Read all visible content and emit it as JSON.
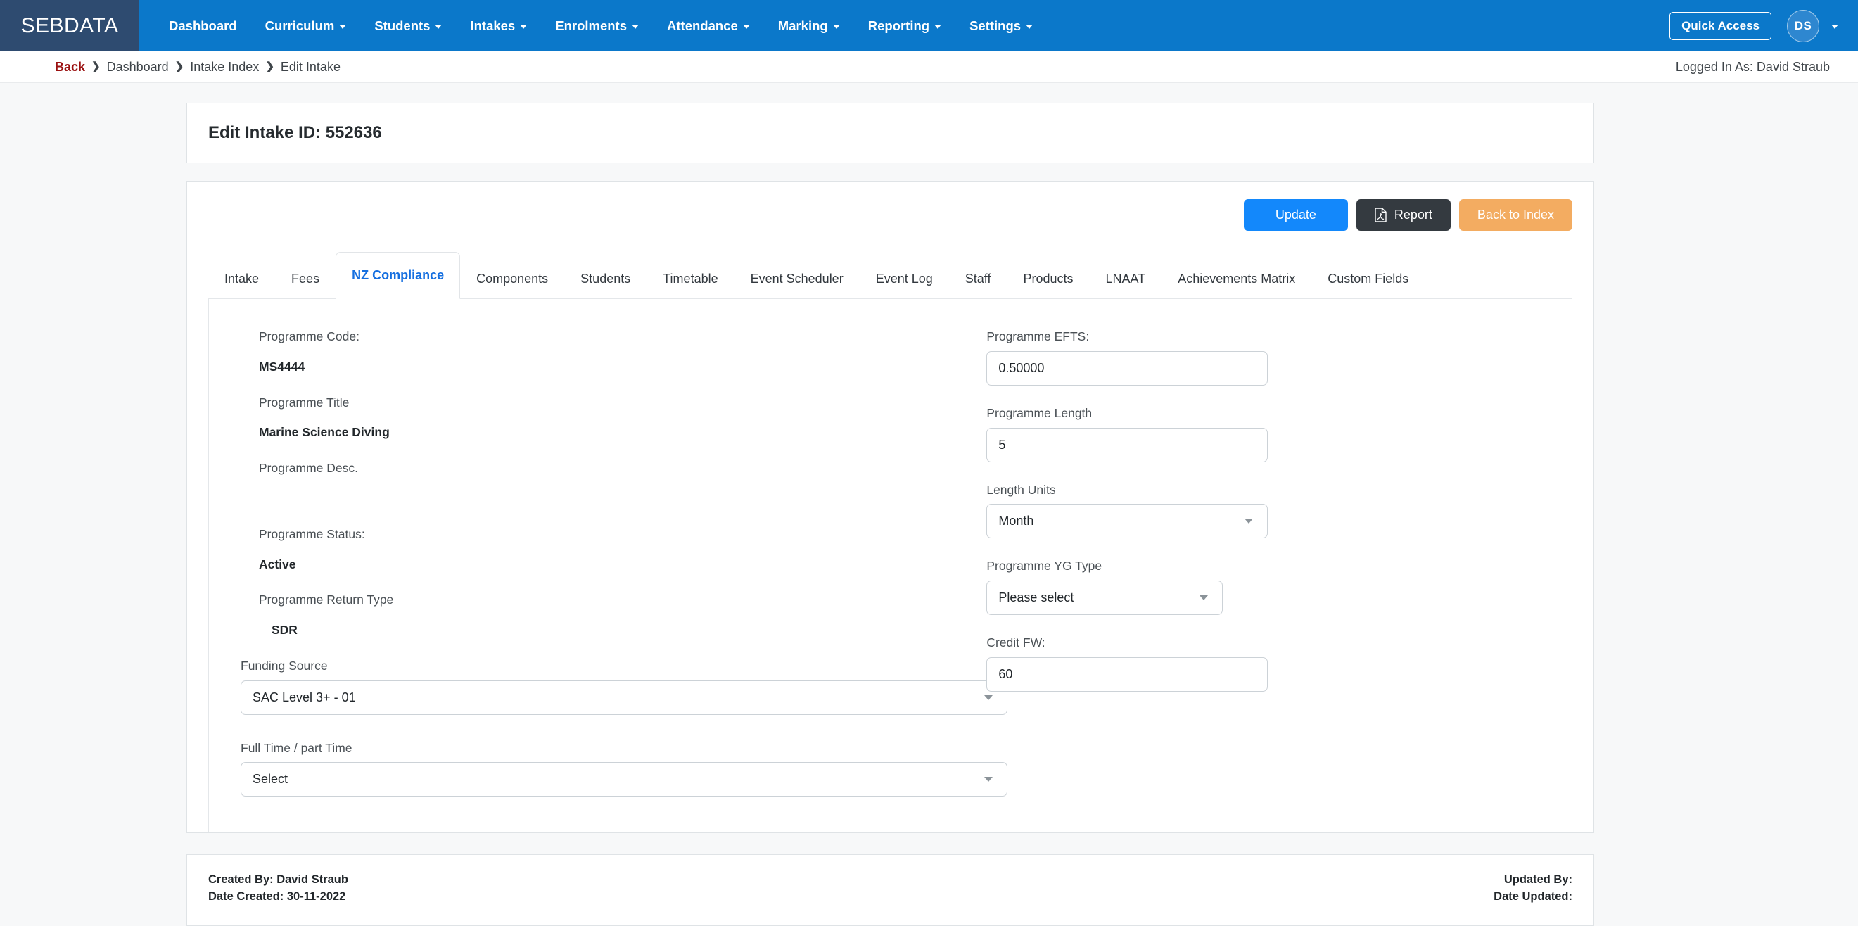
{
  "navbar": {
    "brand": "SEBDATA",
    "items": [
      {
        "label": "Dashboard",
        "has_caret": false
      },
      {
        "label": "Curriculum",
        "has_caret": true
      },
      {
        "label": "Students",
        "has_caret": true
      },
      {
        "label": "Intakes",
        "has_caret": true
      },
      {
        "label": "Enrolments",
        "has_caret": true
      },
      {
        "label": "Attendance",
        "has_caret": true
      },
      {
        "label": "Marking",
        "has_caret": true
      },
      {
        "label": "Reporting",
        "has_caret": true
      },
      {
        "label": "Settings",
        "has_caret": true
      }
    ],
    "quick_access": "Quick Access",
    "avatar_initials": "DS",
    "brand_bg": "#2e4b70",
    "nav_bg": "#0b78ca"
  },
  "breadcrumb": {
    "back": "Back",
    "separator": "❯",
    "items": [
      "Dashboard",
      "Intake Index",
      "Edit Intake"
    ],
    "back_color": "#9b1111"
  },
  "logged_in": "Logged In As: David Straub",
  "page_title": "Edit Intake ID: 552636",
  "toolbar": {
    "update_label": "Update",
    "report_label": "Report",
    "back_to_index_label": "Back to Index",
    "update_color": "#1388fb",
    "report_color": "#343a40",
    "back_to_index_color": "#f3ac61"
  },
  "tabs": {
    "active": "NZ Compliance",
    "active_color": "#156fe0",
    "items": [
      "Intake",
      "Fees",
      "NZ Compliance",
      "Components",
      "Students",
      "Timetable",
      "Event Scheduler",
      "Event Log",
      "Staff",
      "Products",
      "LNAAT",
      "Achievements Matrix",
      "Custom Fields"
    ]
  },
  "form": {
    "left": {
      "programme_code_label": "Programme Code:",
      "programme_code_value": "MS4444",
      "programme_title_label": "Programme Title",
      "programme_title_value": "Marine Science Diving",
      "programme_desc_label": "Programme Desc.",
      "programme_desc_value": "",
      "programme_status_label": "Programme Status:",
      "programme_status_value": "Active",
      "programme_return_type_label": "Programme Return Type",
      "programme_return_type_value": "SDR",
      "funding_source_label": "Funding Source",
      "funding_source_value": "SAC Level 3+ - 01",
      "full_part_time_label": "Full Time / part Time",
      "full_part_time_value": "Select"
    },
    "right": {
      "programme_efts_label": "Programme EFTS:",
      "programme_efts_value": "0.50000",
      "programme_length_label": "Programme Length",
      "programme_length_value": "5",
      "length_units_label": "Length Units",
      "length_units_value": "Month",
      "programme_yg_type_label": "Programme YG Type",
      "programme_yg_type_value": "Please select",
      "credit_fw_label": "Credit FW:",
      "credit_fw_value": "60"
    }
  },
  "footer": {
    "created_by": "Created By: David Straub",
    "date_created": "Date Created: 30-11-2022",
    "updated_by": "Updated By:",
    "date_updated": "Date Updated:"
  }
}
